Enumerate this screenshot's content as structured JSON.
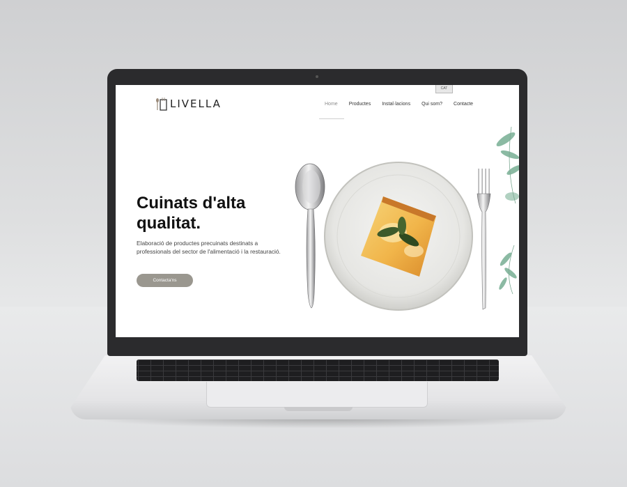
{
  "site": {
    "logo_text": "LIVELLA",
    "lang": "CAT",
    "nav": [
      {
        "label": "Home"
      },
      {
        "label": "Productes"
      },
      {
        "label": "Instal·lacions"
      },
      {
        "label": "Qui som?"
      },
      {
        "label": "Contacte"
      }
    ]
  },
  "hero": {
    "title": "Cuinats d'alta qualitat.",
    "description": "Elaboració de productes precuinats destinats a professionals del sector de l'alimentació i la restauració.",
    "cta_label": "Contacta'ns"
  },
  "colors": {
    "cta_bg": "#9a978f",
    "nav_active": "#8c8c8c",
    "text": "#111111"
  },
  "icons": [
    "fork-spoon-logo-icon",
    "spoon-image",
    "fork-image",
    "plate-image",
    "leaves-image"
  ]
}
